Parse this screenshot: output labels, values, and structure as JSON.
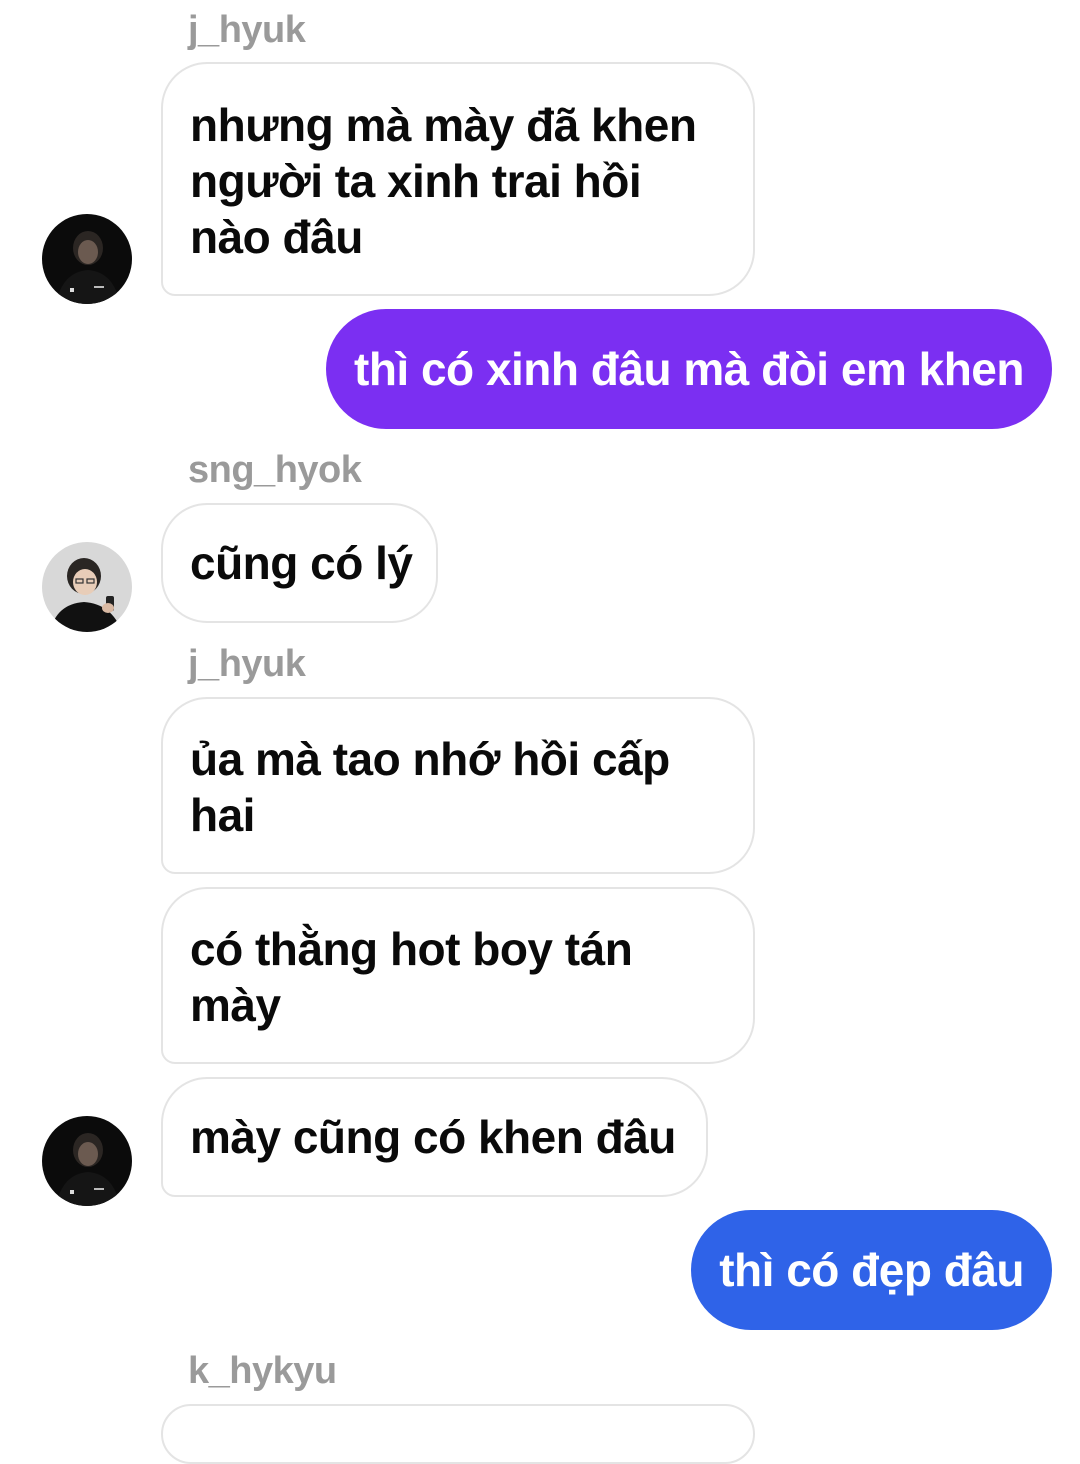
{
  "messages": [
    {
      "type": "sender",
      "text": "j_hyuk"
    },
    {
      "type": "in",
      "text": "nhưng mà mày đã khen người ta xinh trai hồi nào đâu"
    },
    {
      "type": "out",
      "text": "thì có xinh đâu mà đòi em khen",
      "color": "#7b2ff2"
    },
    {
      "type": "sender",
      "text": "sng_hyok"
    },
    {
      "type": "in",
      "text": "cũng có lý"
    },
    {
      "type": "sender",
      "text": "j_hyuk"
    },
    {
      "type": "in",
      "text": "ủa mà tao nhớ hồi cấp hai"
    },
    {
      "type": "in",
      "text": "có thằng hot boy tán mày"
    },
    {
      "type": "in",
      "text": "mày cũng có khen đâu"
    },
    {
      "type": "out",
      "text": "thì có đẹp đâu",
      "color": "#2f63e8"
    },
    {
      "type": "sender",
      "text": "k_hykyu"
    }
  ],
  "avatars": [
    {
      "user": "j_hyuk",
      "icon": "avatar-dark-hoodie"
    },
    {
      "user": "sng_hyok",
      "icon": "avatar-glasses-phone"
    },
    {
      "user": "j_hyuk",
      "icon": "avatar-dark-hoodie"
    }
  ]
}
